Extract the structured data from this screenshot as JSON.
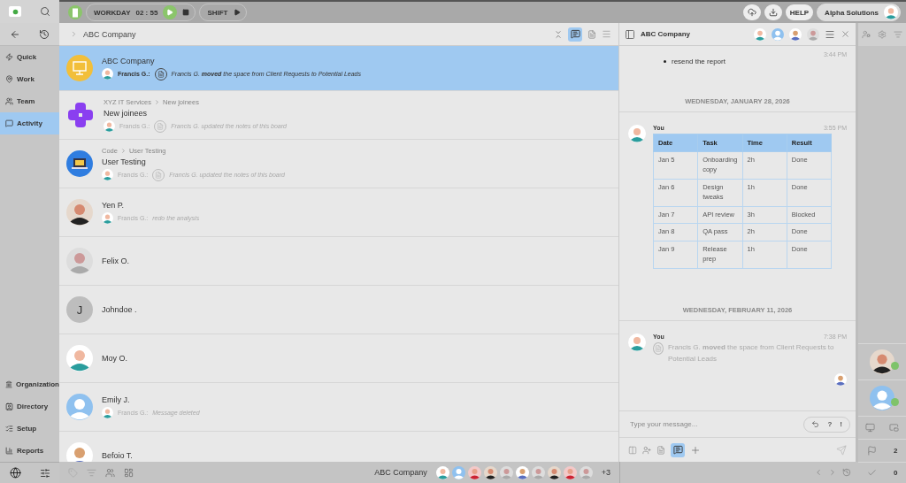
{
  "topbar": {
    "workday_label": "WORKDAY",
    "workday_time": "02 : 55",
    "shift_label": "SHIFT",
    "help": "HELP",
    "account": "Alpha Solutions"
  },
  "sidebar": {
    "nav": [
      {
        "label": "Quick",
        "selected": false
      },
      {
        "label": "Work",
        "selected": false
      },
      {
        "label": "Team",
        "selected": false
      },
      {
        "label": "Activity",
        "selected": true
      }
    ],
    "admin": [
      {
        "label": "Organization"
      },
      {
        "label": "Directory"
      },
      {
        "label": "Setup"
      },
      {
        "label": "Reports"
      }
    ]
  },
  "list": {
    "breadcrumb": "ABC Company",
    "items": [
      {
        "kind": "space",
        "selected": true,
        "title": "ABC Company",
        "author": "Francis G.:",
        "activity": "Francis G.  **moved**  the space from Client Requests to Potential Leads"
      },
      {
        "kind": "space",
        "selected": false,
        "path": [
          "XYZ IT Services",
          "New joinees"
        ],
        "title": "New joinees",
        "author": "Francis G.:",
        "activity": "Francis G. updated the notes of this board"
      },
      {
        "kind": "space",
        "selected": false,
        "path": [
          "Code",
          "User Testing"
        ],
        "title": "User Testing",
        "author": "Francis G.:",
        "activity": "Francis G. updated the notes of this board"
      },
      {
        "kind": "person",
        "selected": false,
        "title": "Yen P.",
        "author": "Francis G.:",
        "message": "redo the analysis"
      },
      {
        "kind": "person",
        "selected": false,
        "title": "Felix O."
      },
      {
        "kind": "initial",
        "selected": false,
        "initial": "J",
        "title": "Johndoe ."
      },
      {
        "kind": "person",
        "selected": false,
        "title": "Moy O."
      },
      {
        "kind": "person",
        "selected": false,
        "title": "Emily J.",
        "author": "Francis G.:",
        "message": "Message deleted"
      },
      {
        "kind": "person",
        "selected": false,
        "title": "Befoio T."
      }
    ]
  },
  "chat": {
    "title": "ABC Company",
    "entries": [
      {
        "kind": "bullet",
        "time": "3:44 PM",
        "text": "resend the report"
      },
      {
        "kind": "date",
        "text": "WEDNESDAY, JANUARY 28, 2026"
      },
      {
        "kind": "table",
        "author": "You",
        "time": "3:55 PM",
        "table": {
          "columns": [
            "Date",
            "Task",
            "Time",
            "Result"
          ],
          "rows": [
            [
              "Jan 5",
              "Onboarding copy",
              "2h",
              "Done"
            ],
            [
              "Jan 6",
              "Design tweaks",
              "1h",
              "Done"
            ],
            [
              "Jan 7",
              "API review",
              "3h",
              "Blocked"
            ],
            [
              "Jan 8",
              "QA pass",
              "2h",
              "Done"
            ],
            [
              "Jan 9",
              "Release prep",
              "1h",
              "Done"
            ]
          ]
        }
      },
      {
        "kind": "date",
        "text": "WEDNESDAY, FEBRUARY 11, 2026"
      },
      {
        "kind": "activity",
        "author": "You",
        "time": "7:38 PM",
        "text": "Francis G. **moved** the space from Client Requests to Potential Leads"
      }
    ],
    "input": {
      "placeholder": "Type your message...",
      "quick": [
        "?",
        "!"
      ]
    }
  },
  "bottom_bar": {
    "space": "ABC Company",
    "more": "+3"
  },
  "right_rail": {
    "flags": "2",
    "checks": "0"
  }
}
